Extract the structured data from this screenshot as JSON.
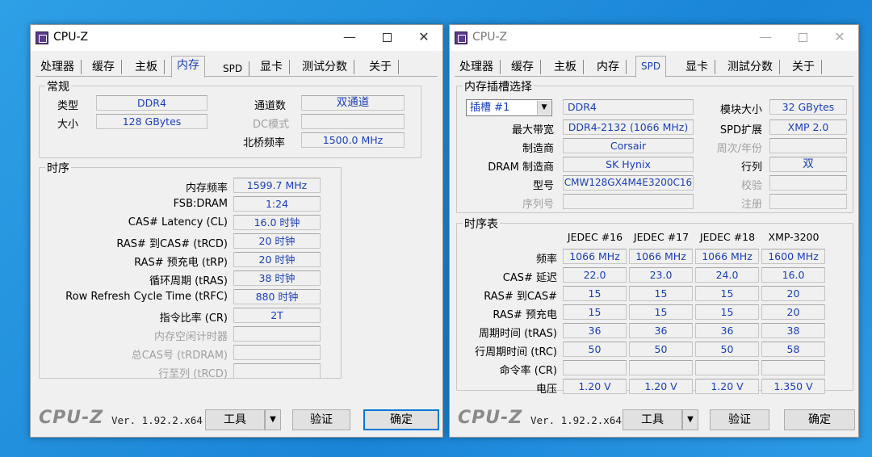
{
  "window1": {
    "title": "CPU-Z",
    "tabs": [
      "处理器",
      "缓存",
      "主板",
      "内存",
      "SPD",
      "显卡",
      "测试分数",
      "关于"
    ],
    "general": {
      "group_title": "常规",
      "type_label": "类型",
      "type_value": "DDR4",
      "size_label": "大小",
      "size_value": "128 GBytes",
      "channels_label": "通道数",
      "channels_value": "双通道",
      "dc_label": "DC模式",
      "dc_value": "",
      "nb_label": "北桥频率",
      "nb_value": "1500.0 MHz"
    },
    "timings": {
      "group_title": "时序",
      "rows": [
        {
          "label": "内存频率",
          "value": "1599.7 MHz"
        },
        {
          "label": "FSB:DRAM",
          "value": "1:24"
        },
        {
          "label": "CAS# Latency (CL)",
          "value": "16.0 时钟"
        },
        {
          "label": "RAS# 到CAS# (tRCD)",
          "value": "20 时钟"
        },
        {
          "label": "RAS# 预充电 (tRP)",
          "value": "20 时钟"
        },
        {
          "label": "循环周期 (tRAS)",
          "value": "38 时钟"
        },
        {
          "label": "Row Refresh Cycle Time (tRFC)",
          "value": "880 时钟"
        },
        {
          "label": "指令比率 (CR)",
          "value": "2T"
        },
        {
          "label": "内存空闲计时器",
          "value": ""
        },
        {
          "label": "总CAS号 (tRDRAM)",
          "value": ""
        },
        {
          "label": "行至列 (tRCD)",
          "value": ""
        }
      ]
    }
  },
  "window2": {
    "title": "CPU-Z",
    "tabs": [
      "处理器",
      "缓存",
      "主板",
      "内存",
      "SPD",
      "显卡",
      "测試分数",
      "关于"
    ],
    "slot": {
      "group_title": "内存插槽选择",
      "slot_select": "插槽 #1",
      "type_value": "DDR4",
      "bandwidth_label": "最大带宽",
      "bandwidth_value": "DDR4-2132 (1066 MHz)",
      "manufacturer_label": "制造商",
      "manufacturer_value": "Corsair",
      "dram_label": "DRAM 制造商",
      "dram_value": "SK Hynix",
      "model_label": "型号",
      "model_value": "CMW128GX4M4E3200C16",
      "serial_label": "序列号",
      "serial_value": "",
      "module_size_label": "模块大小",
      "module_size_value": "32 GBytes",
      "spd_ext_label": "SPD扩展",
      "spd_ext_value": "XMP 2.0",
      "week_year_label": "周次/年份",
      "week_year_value": "",
      "rank_label": "行列",
      "rank_value": "双",
      "correction_label": "校验",
      "correction_value": "",
      "registered_label": "注册",
      "registered_value": ""
    },
    "timing_table": {
      "group_title": "时序表",
      "columns": [
        "JEDEC #16",
        "JEDEC #17",
        "JEDEC #18",
        "XMP-3200"
      ],
      "rows": [
        {
          "label": "频率",
          "values": [
            "1066 MHz",
            "1066 MHz",
            "1066 MHz",
            "1600 MHz"
          ]
        },
        {
          "label": "CAS# 延迟",
          "values": [
            "22.0",
            "23.0",
            "24.0",
            "16.0"
          ]
        },
        {
          "label": "RAS# 到CAS#",
          "values": [
            "15",
            "15",
            "15",
            "20"
          ]
        },
        {
          "label": "RAS# 预充电",
          "values": [
            "15",
            "15",
            "15",
            "20"
          ]
        },
        {
          "label": "周期时间 (tRAS)",
          "values": [
            "36",
            "36",
            "36",
            "38"
          ]
        },
        {
          "label": "行周期时间 (tRC)",
          "values": [
            "50",
            "50",
            "50",
            "58"
          ]
        },
        {
          "label": "命令率 (CR)",
          "values": [
            "",
            "",
            "",
            ""
          ]
        },
        {
          "label": "电压",
          "values": [
            "1.20 V",
            "1.20 V",
            "1.20 V",
            "1.350 V"
          ]
        }
      ]
    }
  },
  "bottom": {
    "logo": "CPU-Z",
    "version": "Ver. 1.92.2.x64",
    "tools_label": "工具",
    "validate_label": "验证",
    "ok_label": "确定"
  },
  "icons": {
    "app": "cpu-z-app-icon",
    "minimize": "minimize-icon",
    "maximize": "maximize-icon",
    "close": "close-icon",
    "dropdown": "chevron-down-icon"
  }
}
